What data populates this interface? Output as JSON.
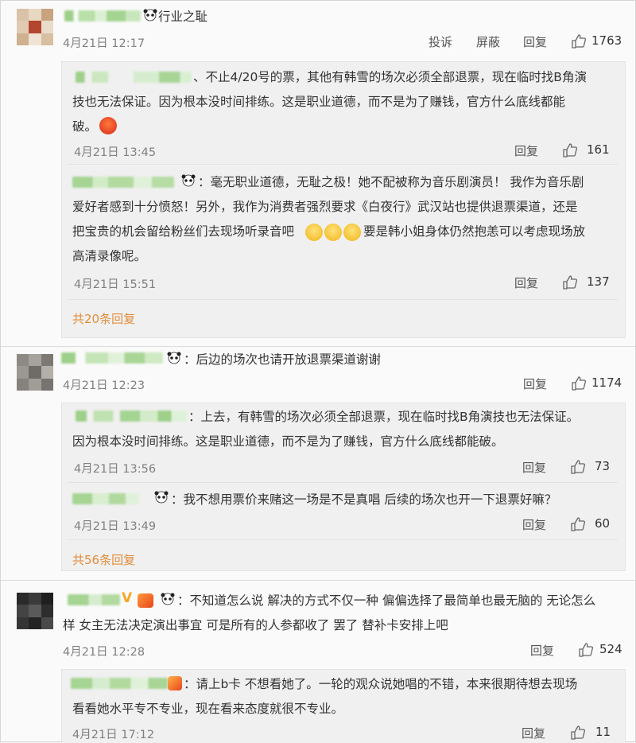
{
  "comments": [
    {
      "text": "行业之耻",
      "time": "4月21日 12:17",
      "actions": {
        "report": "投诉",
        "block": "屏蔽",
        "reply": "回复"
      },
      "likes": "1763",
      "replies": [
        {
          "lines": [
            "、不止4/20号的票，其他有韩雪的场次必须全部退票，现在临时找B角演",
            "技也无法保证。因为根本没时间排练。这是职业道德，而不是为了赚钱，官方什么底线都能",
            "破。"
          ],
          "time": "4月21日 13:45",
          "reply": "回复",
          "likes": "161"
        },
        {
          "lines": [
            "：毫无职业道德，无耻之极！她不配被称为音乐剧演员！ 我作为音乐剧",
            "爱好者感到十分愤怒！另外，我作为消费者强烈要求《白夜行》武汉站也提供退票渠道，还是",
            "把宝贵的机会留给粉丝们去现场听录音吧",
            "要是韩小姐身体仍然抱恙可以考虑现场放",
            "高清录像呢。"
          ],
          "time": "4月21日 15:51",
          "reply": "回复",
          "likes": "137"
        }
      ],
      "more": "共20条回复"
    },
    {
      "text": "：后边的场次也请开放退票渠道谢谢",
      "time": "4月21日 12:23",
      "reply": "回复",
      "likes": "1174",
      "replies": [
        {
          "lines": [
            "：上去，有韩雪的场次必须全部退票，现在临时找B角演技也无法保证。",
            "因为根本没时间排练。这是职业道德，而不是为了赚钱，官方什么底线都能破。"
          ],
          "time": "4月21日 13:56",
          "reply": "回复",
          "likes": "73"
        },
        {
          "lines": [
            "：我不想用票价来赌这一场是不是真唱 后续的场次也开一下退票好嘛？"
          ],
          "time": "4月21日 13:49",
          "reply": "回复",
          "likes": "60"
        }
      ],
      "more": "共56条回复"
    },
    {
      "lines": [
        "：不知道怎么说 解决的方式不仅一种 偏偏选择了最简单也最无脑的 无论怎么",
        "样 女主无法决定演出事宜 可是所有的人参都收了 罢了 替补卡安排上吧"
      ],
      "time": "4月21日 12:28",
      "reply": "回复",
      "likes": "524",
      "replies": [
        {
          "lines": [
            "：请上b卡 不想看她了。一轮的观众说她唱的不错，本来很期待想去现场",
            "看看她水平专不专业，现在看来态度就很不专业。"
          ],
          "time": "4月21日 17:12",
          "reply": "回复",
          "likes": "11"
        }
      ]
    }
  ],
  "colors": {
    "accent_link": "#e38c3a",
    "blur_green": "#9fd08a",
    "time_gray": "#808080"
  },
  "icons": {
    "like": "thumb-up-icon",
    "avatar_emoji": "panda-icon"
  }
}
